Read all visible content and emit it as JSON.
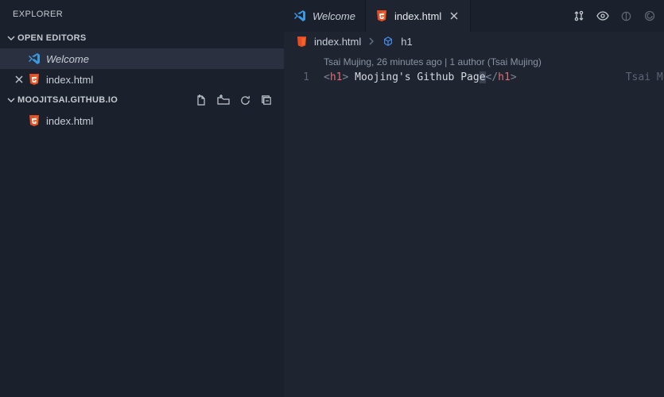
{
  "sidebar": {
    "title": "EXPLORER",
    "openEditorsLabel": "OPEN EDITORS",
    "openEditors": [
      {
        "label": "Welcome",
        "type": "welcome",
        "italic": true,
        "active": true,
        "closable": false
      },
      {
        "label": "index.html",
        "type": "html",
        "italic": false,
        "active": false,
        "closable": true
      }
    ],
    "folderName": "MOOJITSAI.GITHUB.IO",
    "files": [
      {
        "label": "index.html",
        "type": "html"
      }
    ]
  },
  "tabs": [
    {
      "label": "Welcome",
      "type": "welcome",
      "italic": true,
      "active": false,
      "closable": false
    },
    {
      "label": "index.html",
      "type": "html",
      "italic": false,
      "active": true,
      "closable": true
    }
  ],
  "breadcrumbs": {
    "file": "index.html",
    "symbol": "h1"
  },
  "code": {
    "lens": "Tsai Mujing, 26 minutes ago | 1 author (Tsai Mujing)",
    "lineNumber": "1",
    "tagName": "h1",
    "textBefore": " Moojing's Github Pag",
    "textHl": "e",
    "blame": "Tsai Mujin"
  },
  "colors": {
    "html": "#e44d26",
    "vsc": "#3b99e0",
    "cube": "#4a8ef0"
  }
}
